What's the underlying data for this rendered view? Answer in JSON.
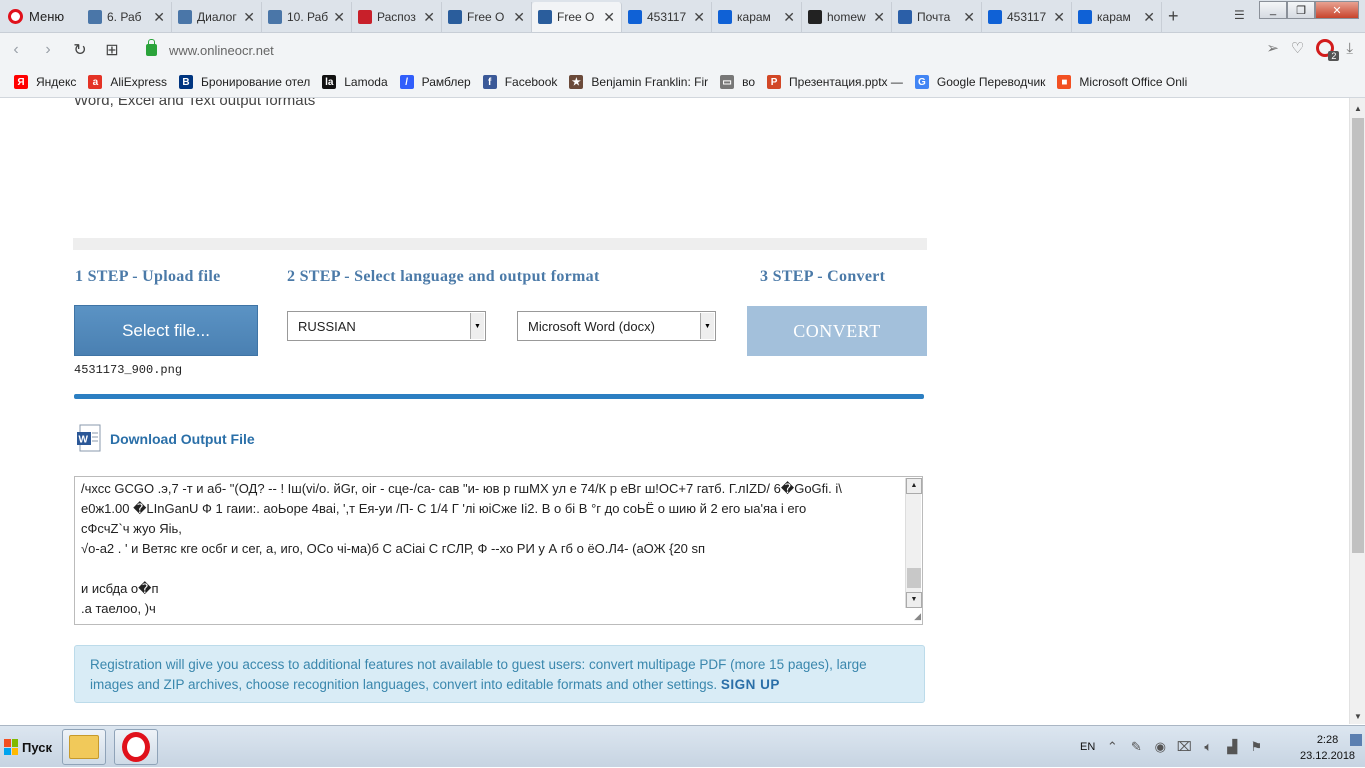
{
  "browser": {
    "menu_label": "Меню",
    "tabs": [
      {
        "label": "6. Раб",
        "icon_color": "#4a76a8"
      },
      {
        "label": "Диалог",
        "icon_color": "#4a76a8"
      },
      {
        "label": "10. Раб",
        "icon_color": "#4a76a8"
      },
      {
        "label": "Распоз",
        "icon_color": "#c8202a"
      },
      {
        "label": "Free O",
        "icon_color": "#2a5d9c"
      },
      {
        "label": "Free O",
        "icon_color": "#2a5d9c",
        "active": true
      },
      {
        "label": "453117",
        "icon_color": "#0f61d6"
      },
      {
        "label": "карам",
        "icon_color": "#0f61d6"
      },
      {
        "label": "homew",
        "icon_color": "#222222"
      },
      {
        "label": "Почта",
        "icon_color": "#2b5fa8"
      },
      {
        "label": "453117",
        "icon_color": "#0f61d6"
      },
      {
        "label": "карам",
        "icon_color": "#0f61d6"
      }
    ],
    "url": "www.onlineocr.net",
    "adblock_count": "2",
    "bookmarks": [
      {
        "label": "Яндекс",
        "icon": "Я",
        "color": "#ff0000"
      },
      {
        "label": "AliExpress",
        "icon": "a",
        "color": "#e43225"
      },
      {
        "label": "Бронирование отел",
        "icon": "B",
        "color": "#003580"
      },
      {
        "label": "Lamoda",
        "icon": "la",
        "color": "#111111"
      },
      {
        "label": "Рамблер",
        "icon": "/",
        "color": "#315efb"
      },
      {
        "label": "Facebook",
        "icon": "f",
        "color": "#3b5998"
      },
      {
        "label": "Benjamin Franklin: Fir",
        "icon": "★",
        "color": "#6b4a3a"
      },
      {
        "label": "во",
        "icon": "▭",
        "color": "#777777"
      },
      {
        "label": "Презентация.pptx —",
        "icon": "P",
        "color": "#d24726"
      },
      {
        "label": "Google Переводчик",
        "icon": "G",
        "color": "#4285f4"
      },
      {
        "label": "Microsoft Office Onli",
        "icon": "■",
        "color": "#f25022"
      }
    ]
  },
  "page": {
    "cut_text": "Word, Excel and Text output formats",
    "step1": "1 STEP - Upload file",
    "step2": "2 STEP - Select language and output format",
    "step3": "3 STEP - Convert",
    "select_file_label": "Select file...",
    "file_name": "4531173_900.png",
    "language": "RUSSIAN",
    "format": "Microsoft Word (docx)",
    "convert_label": "CONVERT",
    "download_label": "Download Output File",
    "ocr_lines": [
      "/чхсс GCGO .э,7 -т и аб- \"(ОД? -- ! Iш(vi/о. йGr, oiг - сце-/са- сав \"и- юв р гшМХ ул е 74/К р еВг ш!ОС+7 гатб. Г.лIZD/ 6�GoGfi. i\\",
      "е0ж1.00 �LInGanU Ф 1 гаии:. аоЬоре 4ваi, ',т Ея-уи /П- С 1/4 Г 'лi юiСже Ii2. В о бi В °г до соЬЁ о шию й 2 его ыа'яа i его",
      "сФсчZ`ч жуо Яiь,",
      "√о-а2 . ' и Ветяс кге осбг и сег, а, иго, ОСо чi-ма)б С аСiаi С гСЛР, Ф --хо РИ у А гб о ёО.Л4- (аОЖ {20 sп",
      "",
      "и исбда о�п",
      ".а таелоо, )ч"
    ],
    "info_text": "Registration will give you access to additional features not available to guest users: convert multipage PDF (more 15 pages), large images and ZIP archives, choose recognition languages, convert into editable formats and other settings.",
    "signup_label": "SIGN UP"
  },
  "taskbar": {
    "start_label": "Пуск",
    "lang": "EN",
    "time": "2:28",
    "date": "23.12.2018"
  }
}
